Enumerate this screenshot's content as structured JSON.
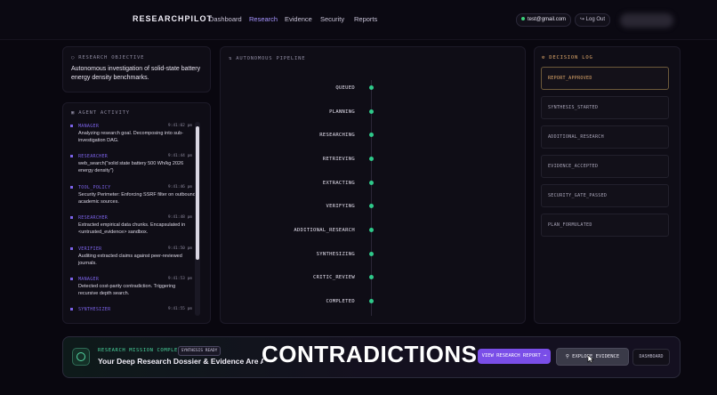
{
  "nav": {
    "brand": "RESEARCHPILOT",
    "links": [
      "Dashboard",
      "Research",
      "Evidence",
      "Security",
      "Reports"
    ],
    "active": "Research",
    "email": "test@gmail.com",
    "logout": "Log Out"
  },
  "objective": {
    "title": "RESEARCH OBJECTIVE",
    "text": "Autonomous investigation of solid-state battery energy density benchmarks."
  },
  "activity": {
    "title": "AGENT ACTIVITY",
    "items": [
      {
        "role": "MANAGER",
        "time": "9:41:02 pm",
        "msg": "Analyzing research goal. Decomposing into sub-investigation DAG."
      },
      {
        "role": "RESEARCHER",
        "time": "9:41:44 pm",
        "msg": "web_search(\"solid state battery 500 Wh/kg 2026 energy density\")"
      },
      {
        "role": "TOOL_POLICY",
        "time": "9:41:46 pm",
        "msg": "Security Perimeter: Enforcing SSRF filter on outbound academic sources."
      },
      {
        "role": "RESEARCHER",
        "time": "9:41:48 pm",
        "msg": "Extracted empirical data chunks. Encapsulated in <untrusted_evidence> sandbox."
      },
      {
        "role": "VERIFIER",
        "time": "9:41:50 pm",
        "msg": "Auditing extracted claims against peer-reviewed journals."
      },
      {
        "role": "MANAGER",
        "time": "9:41:53 pm",
        "msg": "Detected cost-parity contradiction. Triggering recursive depth search."
      },
      {
        "role": "SYNTHESIZER",
        "time": "9:41:55 pm",
        "msg": ""
      }
    ]
  },
  "pipeline": {
    "title": "AUTONOMOUS PIPELINE",
    "stages": [
      "QUEUED",
      "PLANNING",
      "RESEARCHING",
      "RETRIEVING",
      "EXTRACTING",
      "VERIFYING",
      "ADDITIONAL_RESEARCH",
      "SYNTHESIZING",
      "CRITIC_REVIEW",
      "COMPLETED"
    ]
  },
  "decision": {
    "title": "DECISION LOG",
    "items": [
      "REPORT_APPROVED",
      "SYNTHESIS_STARTED",
      "ADDITIONAL_RESEARCH",
      "EVIDENCE_ACCEPTED",
      "SECURITY_GATE_PASSED",
      "PLAN_FORMULATED"
    ]
  },
  "banner": {
    "label": "RESEARCH MISSION COMPLETE",
    "badge": "SYNTHESIS READY",
    "title": "Your Deep Research Dossier & Evidence Are Av",
    "overlay": "CONTRADICTIONS",
    "report_btn": "VIEW RESEARCH REPORT →",
    "evidence_btn": "EXPLORE EVIDENCE",
    "dash_btn": "DASHBOARD"
  },
  "colors": {
    "accent": "#7a4ee8",
    "success": "#2fc98a",
    "warning": "#e0a86a"
  }
}
